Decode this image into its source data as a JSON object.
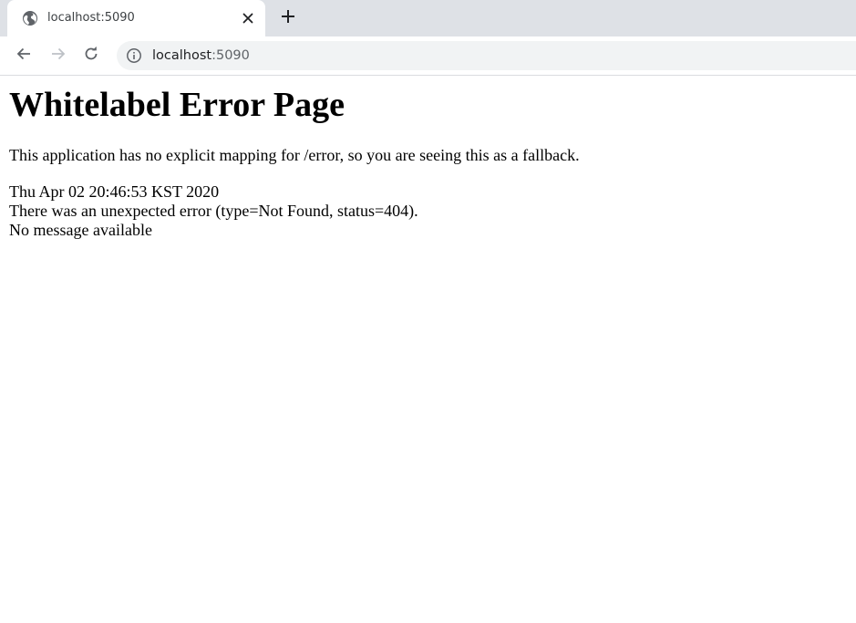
{
  "browser": {
    "tab": {
      "title": "localhost:5090",
      "favicon": "globe-icon"
    },
    "toolbar": {
      "back": "back-arrow-icon",
      "forward": "forward-arrow-icon",
      "reload": "reload-icon",
      "site_info": "info-icon",
      "url_host": "localhost",
      "url_port": ":5090"
    }
  },
  "page": {
    "heading": "Whitelabel Error Page",
    "message": "This application has no explicit mapping for /error, so you are seeing this as a fallback.",
    "error_lines": {
      "timestamp": "Thu Apr 02 20:46:53 KST 2020",
      "error": "There was an unexpected error (type=Not Found, status=404).",
      "detail": "No message available"
    }
  },
  "colors": {
    "tabstrip": "#dee1e6",
    "omnibox": "#f1f3f4",
    "icon": "#5f6368",
    "icon_disabled": "#bdc1c6"
  }
}
